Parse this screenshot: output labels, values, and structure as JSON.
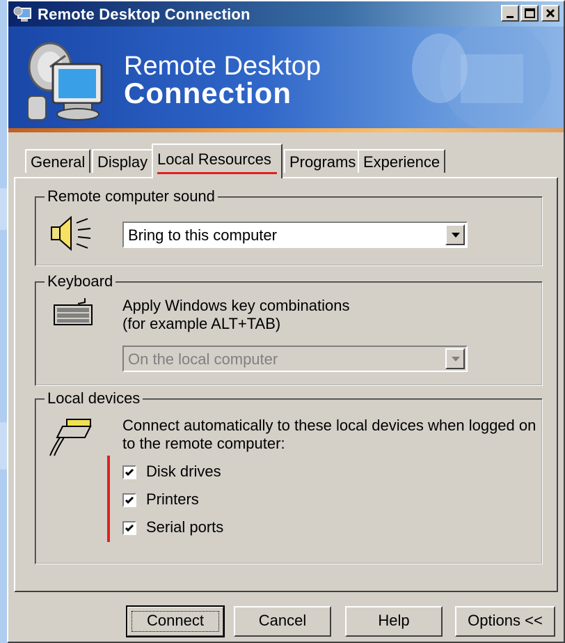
{
  "window": {
    "title": "Remote Desktop Connection"
  },
  "banner": {
    "line1": "Remote Desktop",
    "line2": "Connection"
  },
  "tabs": [
    {
      "label": "General",
      "active": false
    },
    {
      "label": "Display",
      "active": false
    },
    {
      "label": "Local Resources",
      "active": true
    },
    {
      "label": "Programs",
      "active": false
    },
    {
      "label": "Experience",
      "active": false
    }
  ],
  "sound": {
    "legend": "Remote computer sound",
    "icon": "speaker-icon",
    "selected": "Bring to this computer"
  },
  "keyboard": {
    "legend": "Keyboard",
    "icon": "keyboard-icon",
    "line1": "Apply Windows key combinations",
    "line2": "(for example ALT+TAB)",
    "selected": "On the local computer"
  },
  "devices": {
    "legend": "Local devices",
    "icon": "device-plug-icon",
    "line1": "Connect automatically to these local devices when logged on",
    "line2": "to the remote computer:",
    "items": [
      {
        "label": "Disk drives",
        "checked": true
      },
      {
        "label": "Printers",
        "checked": true
      },
      {
        "label": "Serial ports",
        "checked": true
      }
    ]
  },
  "buttons": {
    "connect": "Connect",
    "cancel": "Cancel",
    "help": "Help",
    "options": "Options <<"
  },
  "colors": {
    "titlebar": "#0a246a",
    "banner": "#2f66c8",
    "dialog": "#d4d0c8",
    "highlight": "#e02020"
  }
}
